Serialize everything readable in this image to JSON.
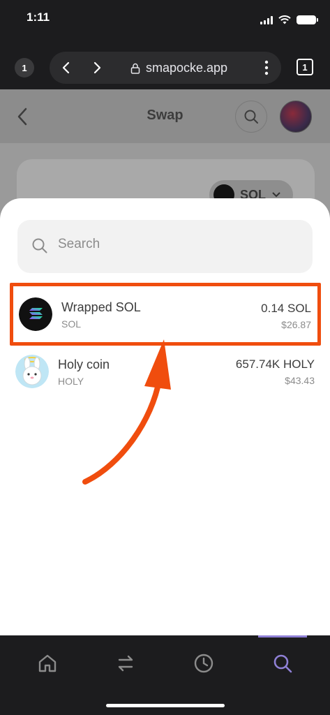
{
  "status_bar": {
    "time": "1:11",
    "signal_icon": "signal-icon",
    "wifi_icon": "wifi-icon",
    "battery_icon": "battery-icon"
  },
  "browser": {
    "tab_count_left": "1",
    "url": "smapocke.app",
    "tab_count_right": "1"
  },
  "app_header": {
    "title": "Swap"
  },
  "behind_sheet": {
    "token_pill_label": "SOL"
  },
  "sheet": {
    "search": {
      "placeholder": "Search"
    },
    "tokens": [
      {
        "name": "Wrapped SOL",
        "symbol": "SOL",
        "balance": "0.14 SOL",
        "value": "$26.87",
        "highlighted": true
      },
      {
        "name": "Holy coin",
        "symbol": "HOLY",
        "balance": "657.74K HOLY",
        "value": "$43.43",
        "highlighted": false
      }
    ]
  },
  "tab_bar": {
    "items": [
      "home-icon",
      "swap-icon",
      "history-icon",
      "search-icon"
    ],
    "active": "search-icon"
  },
  "colors": {
    "highlight": "#f04d0e",
    "active_tab": "#8f80d6",
    "sheet_bg": "#ffffff"
  }
}
